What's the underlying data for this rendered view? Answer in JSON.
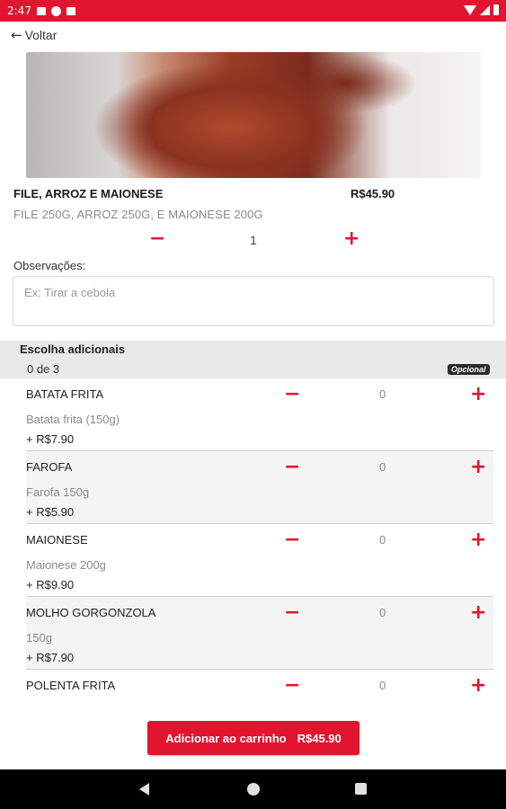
{
  "status_bar": {
    "time": "2:47"
  },
  "header": {
    "back_label": "Voltar"
  },
  "product": {
    "name": "FILE, ARROZ E MAIONESE",
    "price": "R$45.90",
    "description": "FILE 250G, ARROZ 250G, E MAIONESE 200G",
    "quantity": "1"
  },
  "observations": {
    "label": "Observações:",
    "placeholder": "Ex: Tirar a cebola"
  },
  "addons_section": {
    "title": "Escolha adicionais",
    "count_text": "0 de 3",
    "badge": "Opcional",
    "items": [
      {
        "name": "BATATA FRITA",
        "description": "Batata frita (150g)",
        "price": "+ R$7.90",
        "count": "0"
      },
      {
        "name": "FAROFA",
        "description": "Farofa 150g",
        "price": "+ R$5.90",
        "count": "0"
      },
      {
        "name": "MAIONESE",
        "description": "Maionese 200g",
        "price": "+ R$9.90",
        "count": "0"
      },
      {
        "name": "MOLHO GORGONZOLA",
        "description": "150g",
        "price": "+ R$7.90",
        "count": "0"
      },
      {
        "name": "POLENTA FRITA",
        "description": "",
        "price": "",
        "count": "0"
      }
    ]
  },
  "cart_button": {
    "label": "Adicionar ao carrinho",
    "price": "R$45.90"
  },
  "icons": {
    "minus": "−",
    "plus": "+",
    "back_arrow": "🡐",
    "accent_color": "#e2152f"
  }
}
